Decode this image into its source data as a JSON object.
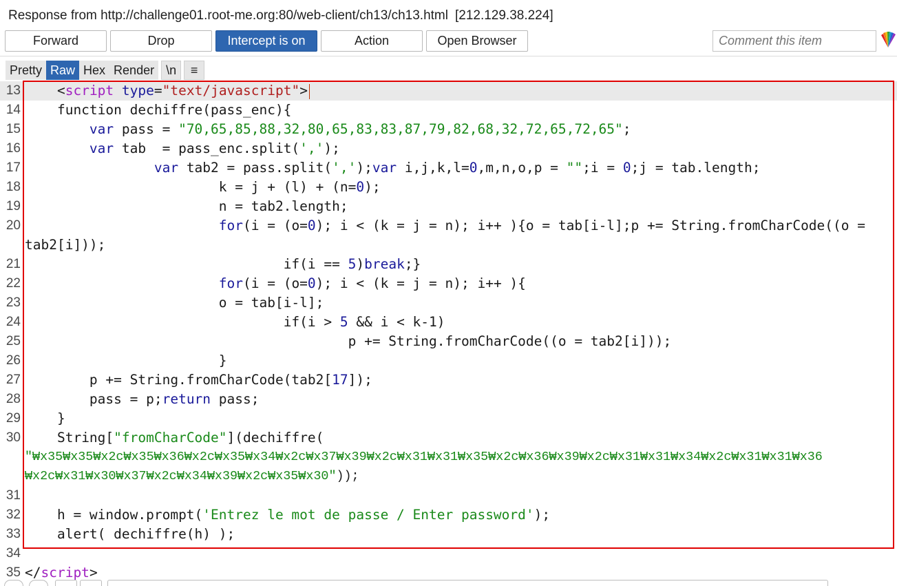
{
  "header": {
    "title": "Response from http://challenge01.root-me.org:80/web-client/ch13/ch13.html",
    "ip": "[212.129.38.224]"
  },
  "toolbar": {
    "forward": "Forward",
    "drop": "Drop",
    "intercept": "Intercept is on",
    "action": "Action",
    "open_browser": "Open Browser",
    "comment_placeholder": "Comment this item"
  },
  "view_tabs": {
    "pretty": "Pretty",
    "raw": "Raw",
    "hex": "Hex",
    "render": "Render",
    "newline": "\\n",
    "menu": "≡"
  },
  "code": {
    "line_numbers": [
      "13",
      "14",
      "15",
      "16",
      "17",
      "18",
      "19",
      "20",
      "21",
      "22",
      "23",
      "24",
      "25",
      "26",
      "27",
      "28",
      "29",
      "30",
      "31",
      "32",
      "33",
      "34",
      "35"
    ],
    "l13_open": "<",
    "l13_tag": "script",
    "l13_attr": "type",
    "l13_eq": "=",
    "l13_val": "\"text/javascript\"",
    "l13_close": ">",
    "l14": "    function dechiffre(pass_enc){",
    "l15_kw": "var",
    "l15_mid": " pass = ",
    "l15_str": "\"70,65,85,88,32,80,65,83,83,87,79,82,68,32,72,65,72,65\"",
    "l15_end": ";",
    "l16_kw": "var",
    "l16_mid": " tab  = pass_enc.split(",
    "l16_str": "','",
    "l16_end": ");",
    "l17_kw1": "var",
    "l17_a": " tab2 = pass.split(",
    "l17_str1": "','",
    "l17_b": ");",
    "l17_kw2": "var",
    "l17_c": " i,j,k,l=",
    "l17_n0": "0",
    "l17_d": ",m,n,o,p = ",
    "l17_str2": "\"\"",
    "l17_e": ";i = ",
    "l17_n1": "0",
    "l17_f": ";j = tab.length;",
    "l18_a": "k = j + (l) + (n=",
    "l18_n": "0",
    "l18_b": ");",
    "l19": "n = tab2.length;",
    "l20_kw": "for",
    "l20_a": "(i = (o=",
    "l20_n": "0",
    "l20_b": "); i < (k = j = n); i++ ){o = tab[i-l];p += String.fromCharCode((o =",
    "l20_cont": "tab2[i]));",
    "l21_a": "if(i == ",
    "l21_n": "5",
    "l21_b": ")",
    "l21_kw": "break",
    "l21_c": ";}",
    "l22_kw": "for",
    "l22_a": "(i = (o=",
    "l22_n": "0",
    "l22_b": "); i < (k = j = n); i++ ){",
    "l23": "o = tab[i-l];",
    "l24_a": "if(i > ",
    "l24_n": "5",
    "l24_b": " && i < k-1)",
    "l25": "p += String.fromCharCode((o = tab2[i]));",
    "l26": "}",
    "l27_a": "p += String.fromCharCode(tab2[",
    "l27_n": "17",
    "l27_b": "]);",
    "l28_a": "pass = p;",
    "l28_kw": "return",
    "l28_b": " pass;",
    "l29": "}",
    "l30_a": "String[",
    "l30_str": "\"fromCharCode\"",
    "l30_b": "](dechiffre(",
    "l30_cont1": "\"₩x35₩x35₩x2c₩x35₩x36₩x2c₩x35₩x34₩x2c₩x37₩x39₩x2c₩x31₩x31₩x35₩x2c₩x36₩x39₩x2c₩x31₩x31₩x34₩x2c₩x31₩x31₩x36",
    "l30_cont2a": "₩x2c₩x31₩x30₩x37₩x2c₩x34₩x39₩x2c₩x35₩x30\"",
    "l30_cont2b": "));",
    "l32_a": "h = window.prompt(",
    "l32_str": "'Entrez le mot de passe / Enter password'",
    "l32_b": ");",
    "l33": "alert( dechiffre(h) );",
    "l35_a": "</",
    "l35_tag": "script",
    "l35_b": ">"
  },
  "colors": {
    "accent_blue": "#2e66b0",
    "highlight_red": "#e00000",
    "string_green": "#1a8a1a",
    "keyword_navy": "#1a1a9a",
    "tag_purple": "#a020c0"
  }
}
